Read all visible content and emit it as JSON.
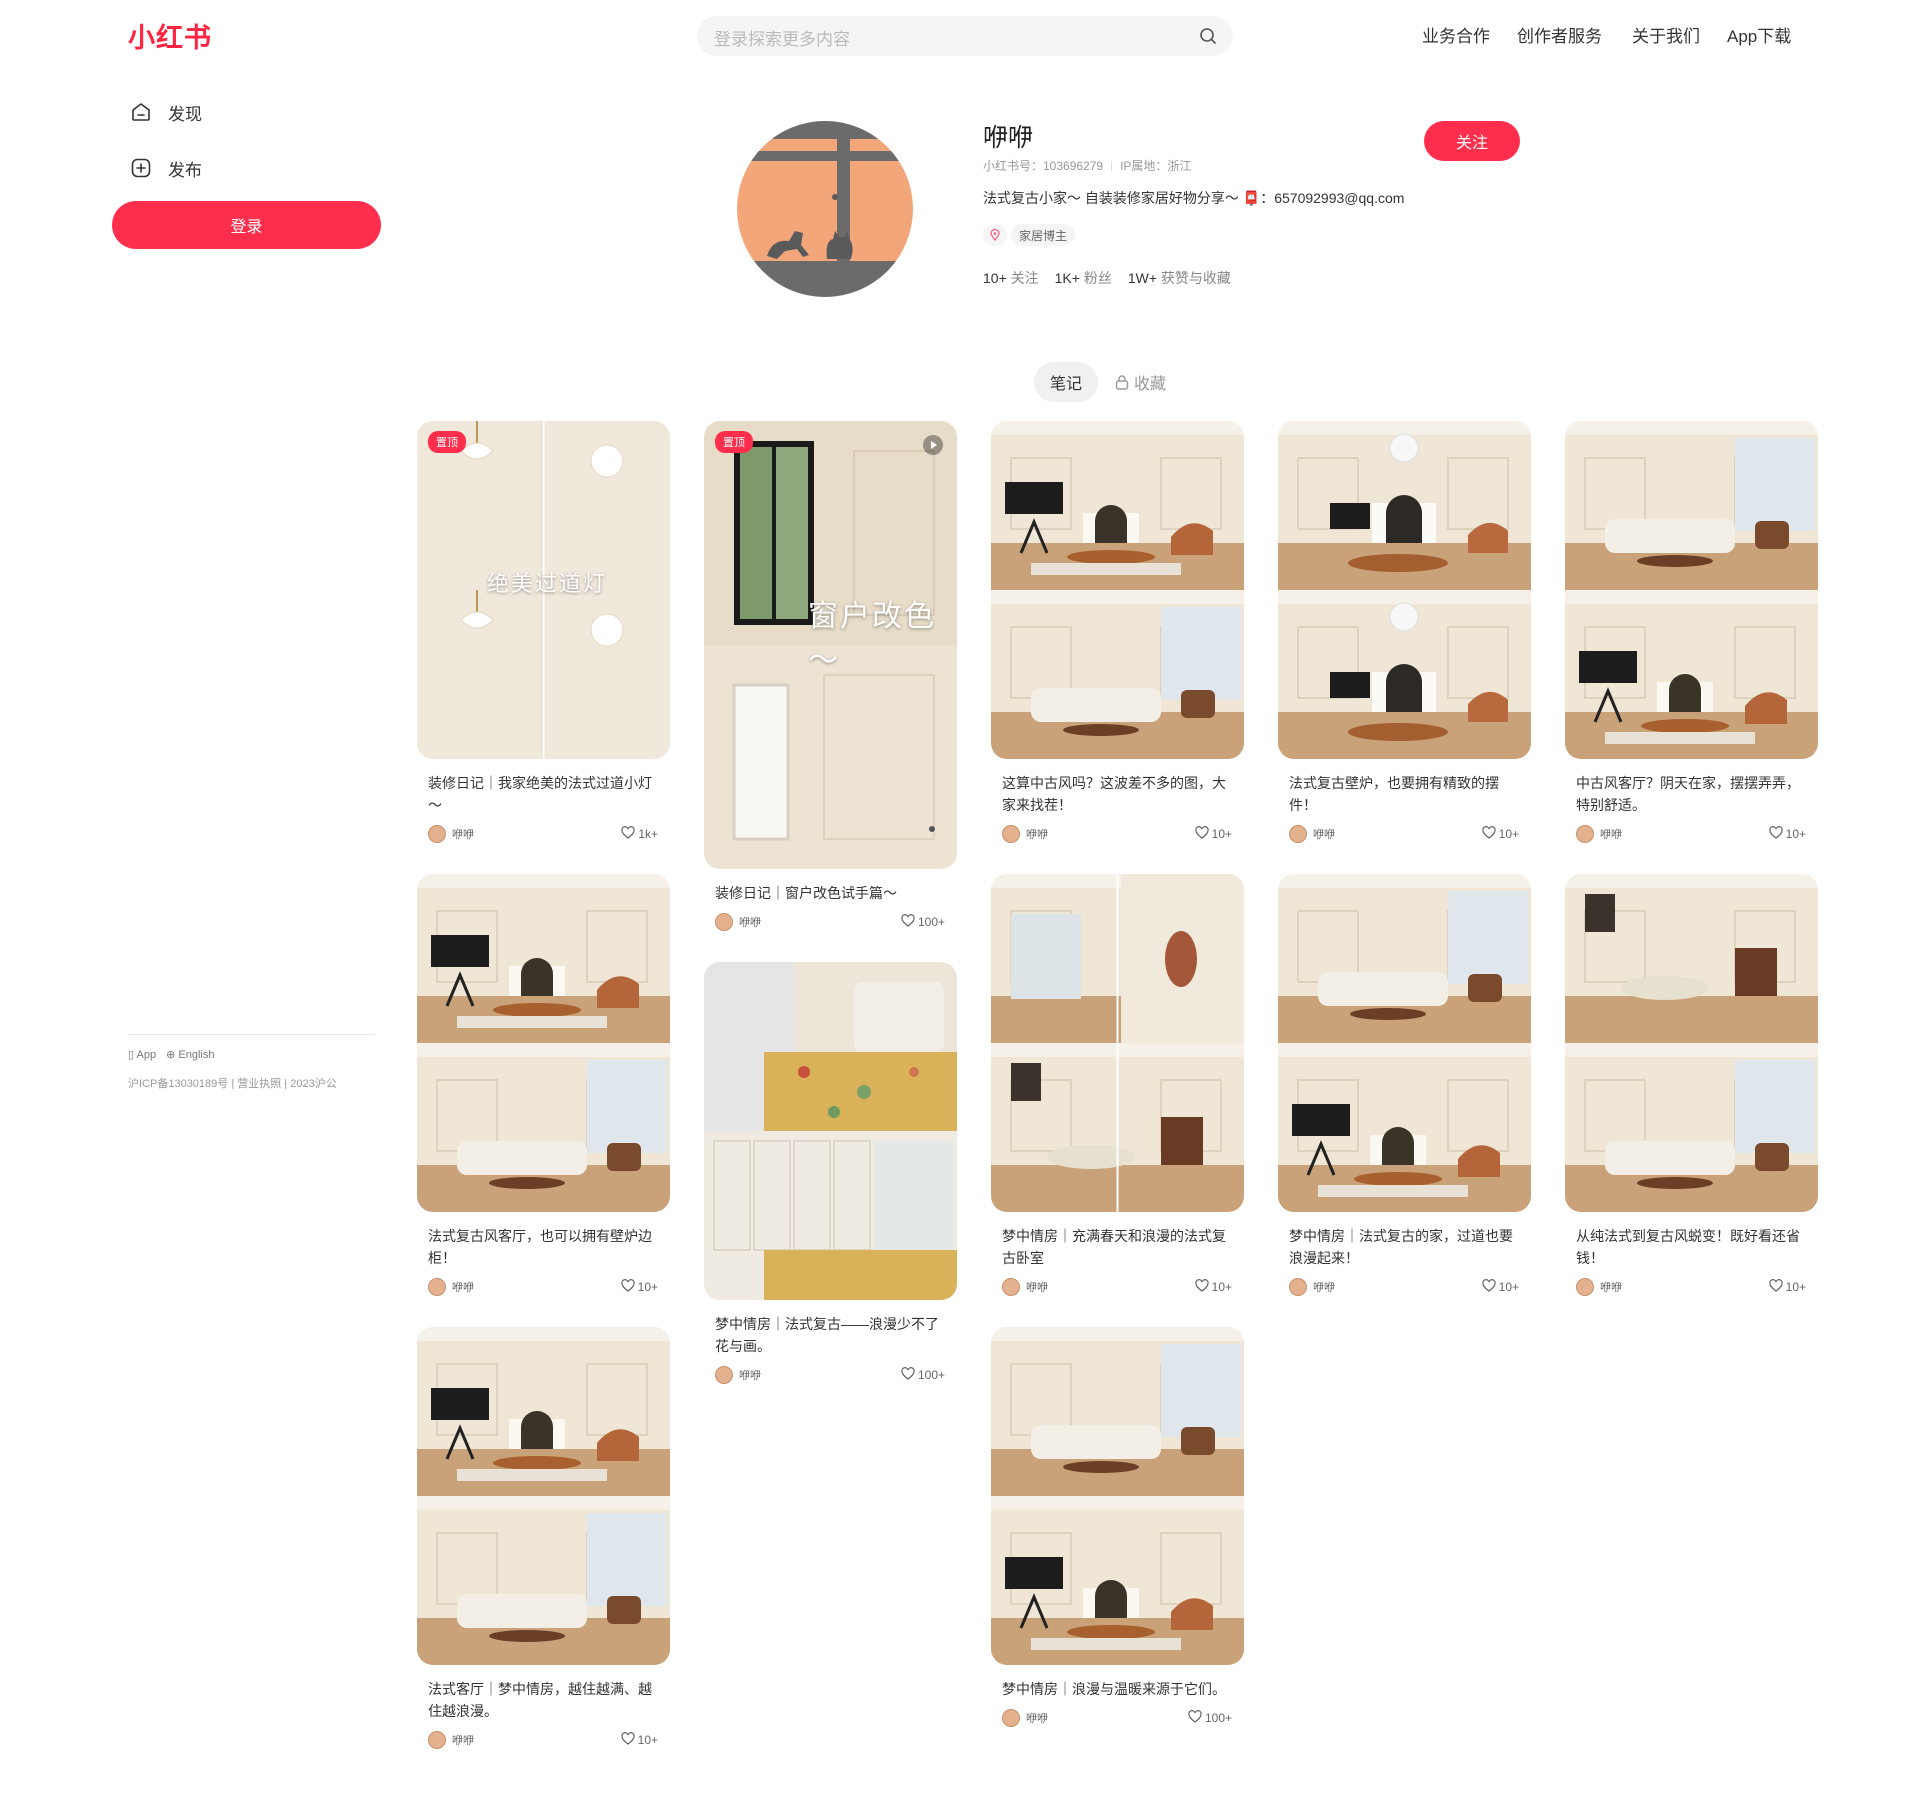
{
  "header": {
    "logo": "小红书",
    "search_placeholder": "登录探索更多内容",
    "nav": [
      "业务合作",
      "创作者服务",
      "关于我们",
      "App下载"
    ]
  },
  "sidebar": {
    "items": [
      {
        "label": "发现",
        "icon": "home-icon"
      },
      {
        "label": "发布",
        "icon": "add-post-icon"
      }
    ],
    "login_label": "登录",
    "footer_links": [
      "App",
      "English"
    ],
    "icp": "沪ICP备13030189号 | 营业执照 | 2023沪公"
  },
  "profile": {
    "name": "咿咿",
    "id_text": "小红书号：103696279",
    "ip_text": "IP属地：浙江",
    "bio": "法式复古小家～ 自装装修家居好物分享～ 📮：657092993@qq.com",
    "tag": "家居博主",
    "follow_label": "关注",
    "stats": [
      {
        "count": "10+",
        "label": "关注"
      },
      {
        "count": "1K+",
        "label": "粉丝"
      },
      {
        "count": "1W+",
        "label": "获赞与收藏"
      }
    ]
  },
  "tabs": {
    "notes": "笔记",
    "collect": "收藏"
  },
  "notes": [
    {
      "title": "装修日记｜我家绝美的法式过道小灯～",
      "author": "咿咿",
      "likes": "1k+",
      "pinned": "置顶",
      "cover_text": "绝美过道灯"
    },
    {
      "title": "这算中古风吗？这波差不多的图，大家来找茬！",
      "author": "咿咿",
      "likes": "10+"
    },
    {
      "title": "法式复古壁炉，也要拥有精致的摆件！",
      "author": "咿咿",
      "likes": "10+"
    },
    {
      "title": "中古风客厅？阴天在家，摆摆弄弄，特别舒适。",
      "author": "咿咿",
      "likes": "10+"
    },
    {
      "title": "装修日记｜窗户改色试手篇～",
      "author": "咿咿",
      "likes": "100+",
      "pinned": "置顶",
      "cover_text": "窗户改色～",
      "video": true
    },
    {
      "title": "法式复古风客厅，也可以拥有壁炉边柜！",
      "author": "咿咿",
      "likes": "10+"
    },
    {
      "title": "梦中情房｜充满春天和浪漫的法式复古卧室",
      "author": "咿咿",
      "likes": "10+"
    },
    {
      "title": "梦中情房｜法式复古的家，过道也要浪漫起来！",
      "author": "咿咿",
      "likes": "10+"
    },
    {
      "title": "从纯法式到复古风蜕变！既好看还省钱！",
      "author": "咿咿",
      "likes": "10+"
    },
    {
      "title": "梦中情房｜法式复古——浪漫少不了花与画。",
      "author": "咿咿",
      "likes": "100+"
    },
    {
      "title": "法式客厅｜梦中情房，越住越满、越住越浪漫。",
      "author": "咿咿",
      "likes": "10+"
    },
    {
      "title": "梦中情房｜浪漫与温暖来源于它们。",
      "author": "咿咿",
      "likes": "100+"
    }
  ]
}
